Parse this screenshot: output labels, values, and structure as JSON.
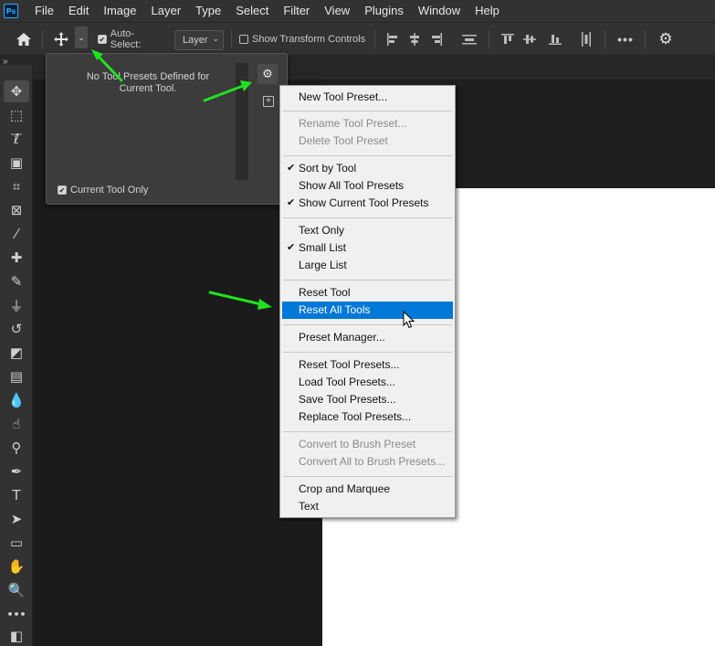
{
  "app": {
    "logo_text": "Ps"
  },
  "menubar": {
    "items": [
      "File",
      "Edit",
      "Image",
      "Layer",
      "Type",
      "Select",
      "Filter",
      "View",
      "Plugins",
      "Window",
      "Help"
    ]
  },
  "options_bar": {
    "auto_select_label": "Auto-Select:",
    "auto_select_checked": true,
    "layer_select_value": "Layer",
    "show_transform_label": "Show Transform Controls",
    "show_transform_checked": false,
    "more_label": "•••"
  },
  "preset_panel": {
    "empty_message": "No Tool Presets Defined for Current Tool.",
    "current_tool_only_label": "Current Tool Only",
    "current_tool_only_checked": true
  },
  "context_menu": {
    "items": [
      {
        "label": "New Tool Preset...",
        "enabled": true,
        "checked": false
      },
      {
        "label": "Rename Tool Preset...",
        "enabled": false,
        "checked": false
      },
      {
        "label": "Delete Tool Preset",
        "enabled": false,
        "checked": false
      },
      {
        "label": "Sort by Tool",
        "enabled": true,
        "checked": true
      },
      {
        "label": "Show All Tool Presets",
        "enabled": true,
        "checked": false
      },
      {
        "label": "Show Current Tool Presets",
        "enabled": true,
        "checked": true
      },
      {
        "label": "Text Only",
        "enabled": true,
        "checked": false
      },
      {
        "label": "Small List",
        "enabled": true,
        "checked": true
      },
      {
        "label": "Large List",
        "enabled": true,
        "checked": false
      },
      {
        "label": "Reset Tool",
        "enabled": true,
        "checked": false
      },
      {
        "label": "Reset All Tools",
        "enabled": true,
        "checked": false,
        "highlighted": true
      },
      {
        "label": "Preset Manager...",
        "enabled": true,
        "checked": false
      },
      {
        "label": "Reset Tool Presets...",
        "enabled": true,
        "checked": false
      },
      {
        "label": "Load Tool Presets...",
        "enabled": true,
        "checked": false
      },
      {
        "label": "Save Tool Presets...",
        "enabled": true,
        "checked": false
      },
      {
        "label": "Replace Tool Presets...",
        "enabled": true,
        "checked": false
      },
      {
        "label": "Convert to Brush Preset",
        "enabled": false,
        "checked": false
      },
      {
        "label": "Convert All to Brush Presets...",
        "enabled": false,
        "checked": false
      },
      {
        "label": "Crop and Marquee",
        "enabled": true,
        "checked": false
      },
      {
        "label": "Text",
        "enabled": true,
        "checked": false
      }
    ],
    "check_glyph": "✔",
    "highlight_color": "#0078d7"
  },
  "annotations": {
    "arrow_color": "#22e022"
  },
  "toolbar": {
    "tools": [
      {
        "name": "move-tool",
        "glyph": "✥",
        "active": true
      },
      {
        "name": "marquee-tool",
        "glyph": "⬚"
      },
      {
        "name": "lasso-tool",
        "glyph": "ℓ"
      },
      {
        "name": "object-select-tool",
        "glyph": "▣"
      },
      {
        "name": "crop-tool",
        "glyph": "⌗"
      },
      {
        "name": "frame-tool",
        "glyph": "⊠"
      },
      {
        "name": "eyedropper-tool",
        "glyph": "⁄"
      },
      {
        "name": "healing-brush-tool",
        "glyph": "✚"
      },
      {
        "name": "brush-tool",
        "glyph": "✎"
      },
      {
        "name": "clone-stamp-tool",
        "glyph": "⏚"
      },
      {
        "name": "history-brush-tool",
        "glyph": "↺"
      },
      {
        "name": "eraser-tool",
        "glyph": "◩"
      },
      {
        "name": "gradient-tool",
        "glyph": "▤"
      },
      {
        "name": "blur-tool",
        "glyph": "💧"
      },
      {
        "name": "smudge-tool",
        "glyph": "☝"
      },
      {
        "name": "dodge-tool",
        "glyph": "⚲"
      },
      {
        "name": "pen-tool",
        "glyph": "✒"
      },
      {
        "name": "type-tool",
        "glyph": "T"
      },
      {
        "name": "path-select-tool",
        "glyph": "➤"
      },
      {
        "name": "rectangle-tool",
        "glyph": "▭"
      },
      {
        "name": "hand-tool",
        "glyph": "✋"
      },
      {
        "name": "zoom-tool",
        "glyph": "🔍"
      },
      {
        "name": "edit-toolbar",
        "glyph": "•••"
      },
      {
        "name": "color-swatches",
        "glyph": "◧"
      }
    ]
  }
}
